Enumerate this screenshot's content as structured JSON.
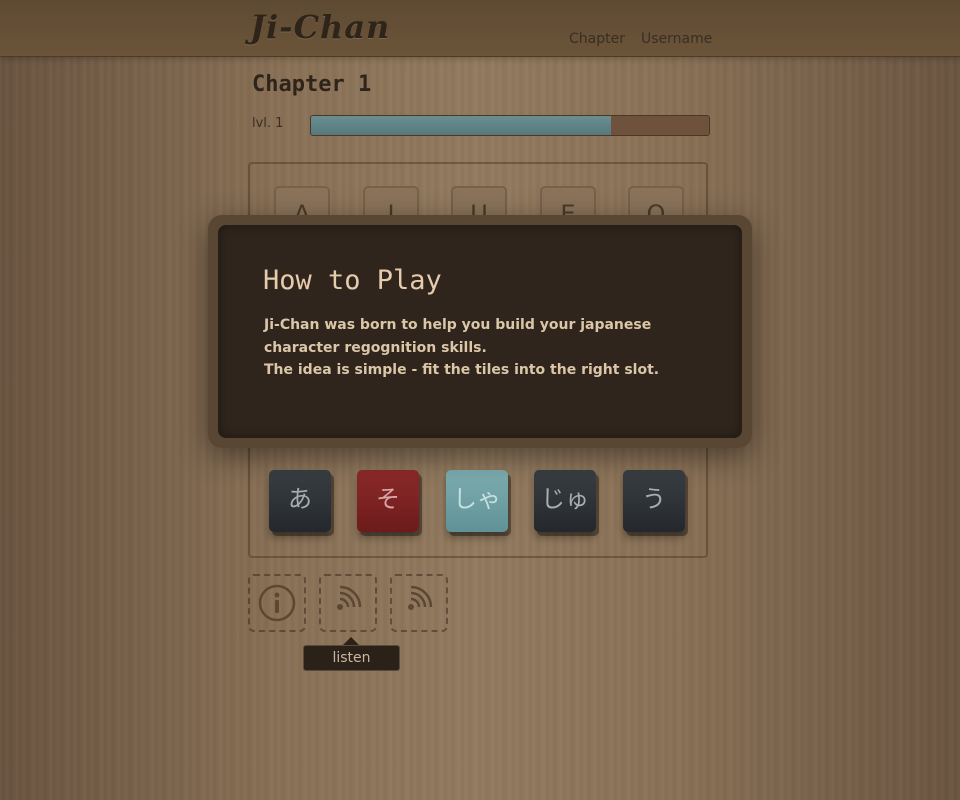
{
  "header": {
    "logo": "Ji-Chan",
    "nav": {
      "chapter": "Chapter",
      "username": "Username"
    }
  },
  "main": {
    "chapter_title": "Chapter 1",
    "level_label": "lvl. 1",
    "progress_fraction": 0.755,
    "slots": [
      "A",
      "I",
      "U",
      "E",
      "O"
    ],
    "tiles": [
      {
        "char": "あ",
        "color": "dark"
      },
      {
        "char": "そ",
        "color": "red"
      },
      {
        "char": "しゃ",
        "color": "teal"
      },
      {
        "char": "じゅ",
        "color": "dark"
      },
      {
        "char": "う",
        "color": "dark"
      }
    ],
    "toolbar": {
      "listen_tooltip": "listen"
    }
  },
  "modal": {
    "title": "How to Play",
    "paragraph1": "Ji-Chan was born to help you build your japanese character regognition skills.",
    "paragraph2": "The idea is simple - fit the tiles into the right slot."
  },
  "colors": {
    "wood_bg": "#8a7156",
    "modal_bg": "#2f251d",
    "progress_fill": "#56797d",
    "tile_red": "#6c1b1b",
    "tile_teal": "#5f9196",
    "tile_dark": "#2a2e33"
  }
}
